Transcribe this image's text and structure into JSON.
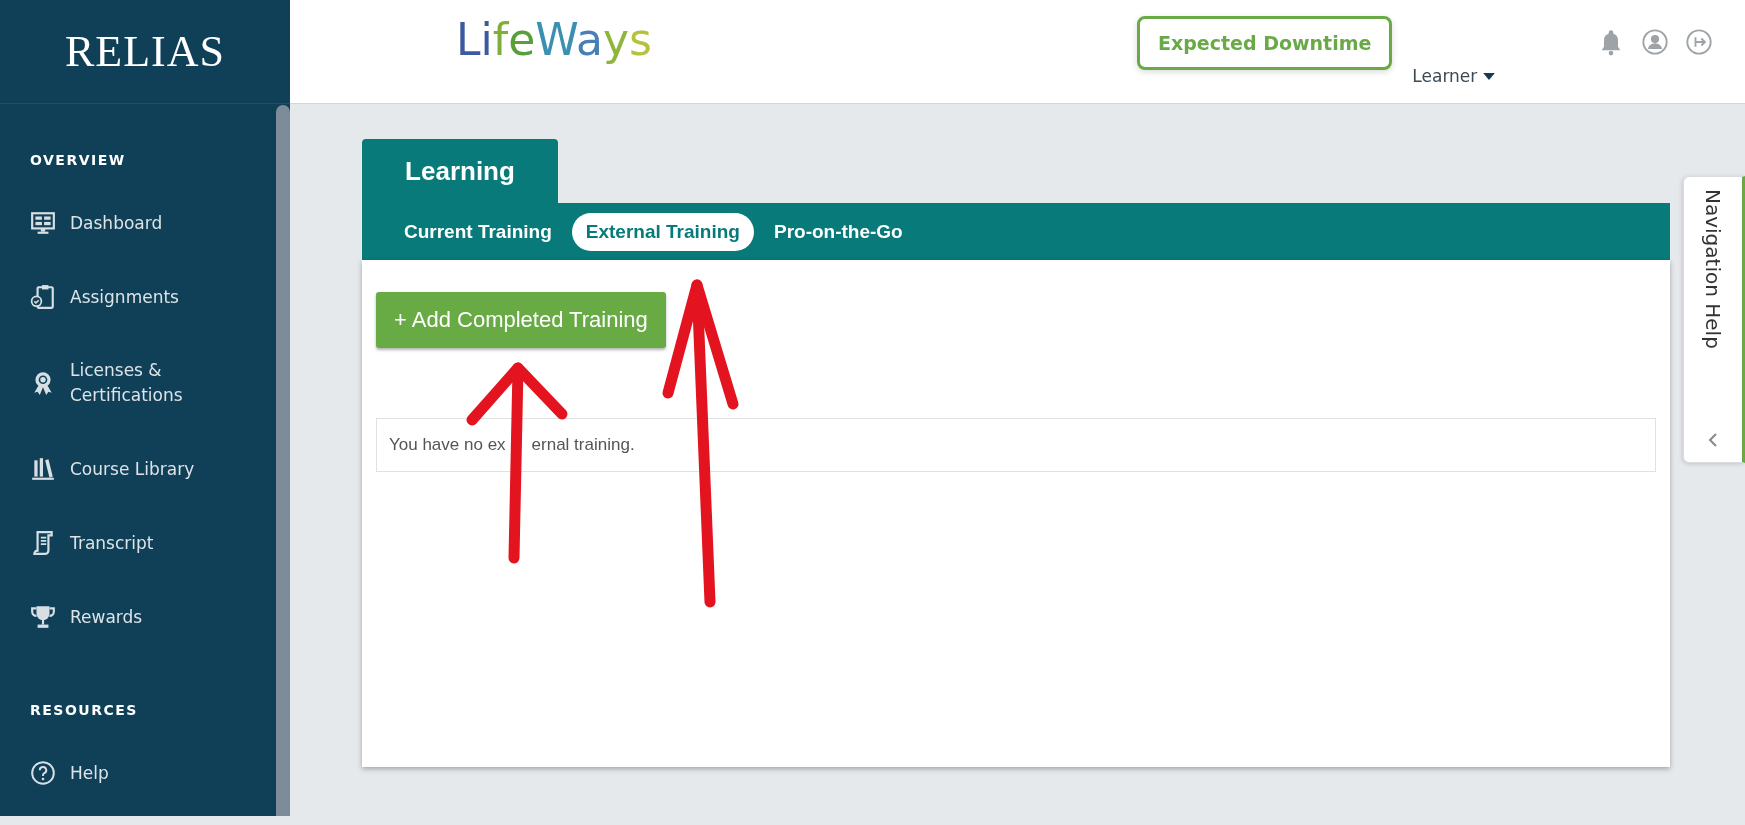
{
  "sidebar": {
    "logo": "RELIAS",
    "sections": [
      {
        "heading": "OVERVIEW",
        "items": [
          {
            "label": "Dashboard",
            "kind": "dashboard"
          },
          {
            "label": "Assignments",
            "kind": "assignments"
          },
          {
            "label": "Licenses &\nCertifications",
            "kind": "licenses"
          },
          {
            "label": "Course Library",
            "kind": "library"
          },
          {
            "label": "Transcript",
            "kind": "transcript"
          },
          {
            "label": "Rewards",
            "kind": "rewards"
          }
        ]
      },
      {
        "heading": "RESOURCES",
        "items": [
          {
            "label": "Help",
            "kind": "help"
          }
        ]
      }
    ]
  },
  "header": {
    "org_logo": "LifeWays",
    "downtime_button": "Expected Downtime",
    "role_menu": "Learner"
  },
  "learning": {
    "title": "Learning",
    "tabs": [
      {
        "label": "Current Training",
        "selected": false
      },
      {
        "label": "External Training",
        "selected": true
      },
      {
        "label": "Pro-on-the-Go",
        "selected": false
      }
    ],
    "add_button": "+ Add Completed Training",
    "empty_message": [
      "You have no ex",
      "ernal training."
    ]
  },
  "navigation_help": {
    "label": "Navigation Help"
  }
}
